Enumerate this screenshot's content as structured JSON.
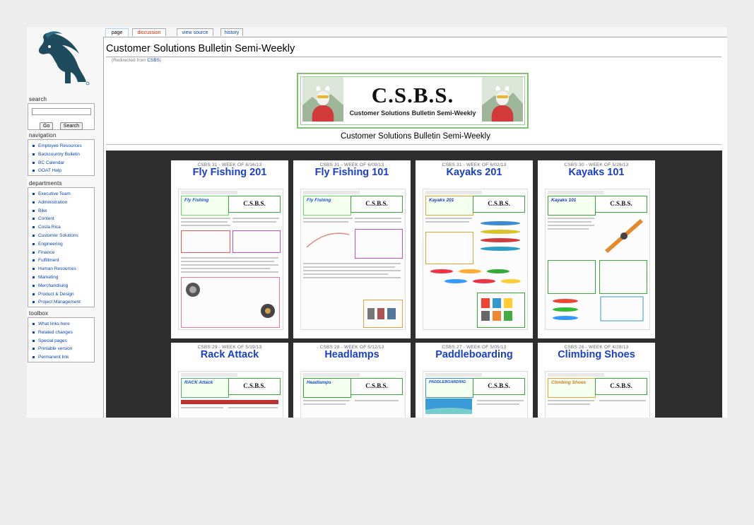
{
  "colors": {
    "link": "#0645ad",
    "card_title": "#1a3fc8",
    "gallery_bg": "#2e2e2e",
    "banner_border": "#7ec26b"
  },
  "tabs": [
    {
      "label": "page",
      "icon": null
    },
    {
      "label": "discussion",
      "color": "#cc2200"
    },
    {
      "label": "view source"
    },
    {
      "label": "history"
    }
  ],
  "sidebar": {
    "search": {
      "heading": "search",
      "placeholder": "",
      "go_label": "Go",
      "search_label": "Search"
    },
    "navigation": {
      "heading": "navigation",
      "items": [
        "Employee Resources",
        "Backcountry Bulletin",
        "BC Calendar",
        "GOAT Help"
      ]
    },
    "departments": {
      "heading": "departments",
      "items": [
        "Executive Team",
        "Administration",
        "Bike",
        "Content",
        "Costa Rica",
        "Customer Solutions",
        "Engineering",
        "Finance",
        "Fulfillment",
        "Human Resources",
        "Marketing",
        "Merchandising",
        "Product & Design",
        "Project Management"
      ]
    },
    "toolbox": {
      "heading": "toolbox",
      "items": [
        "What links here",
        "Related changes",
        "Special pages",
        "Printable version",
        "Permanent link"
      ]
    }
  },
  "page": {
    "title": "Customer Solutions Bulletin Semi-Weekly",
    "redirect_prefix": "(Redirected from ",
    "redirect_link": "CSBS",
    "redirect_suffix": ")",
    "banner_title": "C.S.B.S.",
    "banner_subtitle": "Customer Solutions Bulletin Semi-Weekly",
    "section_title": "Customer Solutions Bulletin Semi-Weekly"
  },
  "cards": [
    {
      "week": "CSBS 31 - WEEK OF 6/16/13",
      "title": "Fly Fishing 201",
      "feature": "Fly Fishing"
    },
    {
      "week": "CSBS 31 - WEEK OF 6/09/13",
      "title": "Fly Fishing 101",
      "feature": "Fly Fishing"
    },
    {
      "week": "CSBS 31 - WEEK OF 6/02/13",
      "title": "Kayaks 201",
      "feature": "Kayaks 201"
    },
    {
      "week": "CSBS 30 - WEEK OF 5/26/13",
      "title": "Kayaks 101",
      "feature": "Kayaks 101"
    },
    {
      "week": "CSBS 29 - WEEK OF 5/19/13",
      "title": "Rack Attack",
      "feature": "RACK Attack"
    },
    {
      "week": "CSBS 28 - WEEK OF 5/12/13",
      "title": "Headlamps",
      "feature": "Headlamps"
    },
    {
      "week": "CSBS 27 - WEEK OF 5/05/13",
      "title": "Paddleboarding",
      "feature": "PADDLEBOARDING"
    },
    {
      "week": "CSBS 26 - WEEK OF 4/28/13",
      "title": "Climbing Shoes",
      "feature": "Climbing Shoes"
    }
  ],
  "card_logo_text": "C.S.B.S."
}
